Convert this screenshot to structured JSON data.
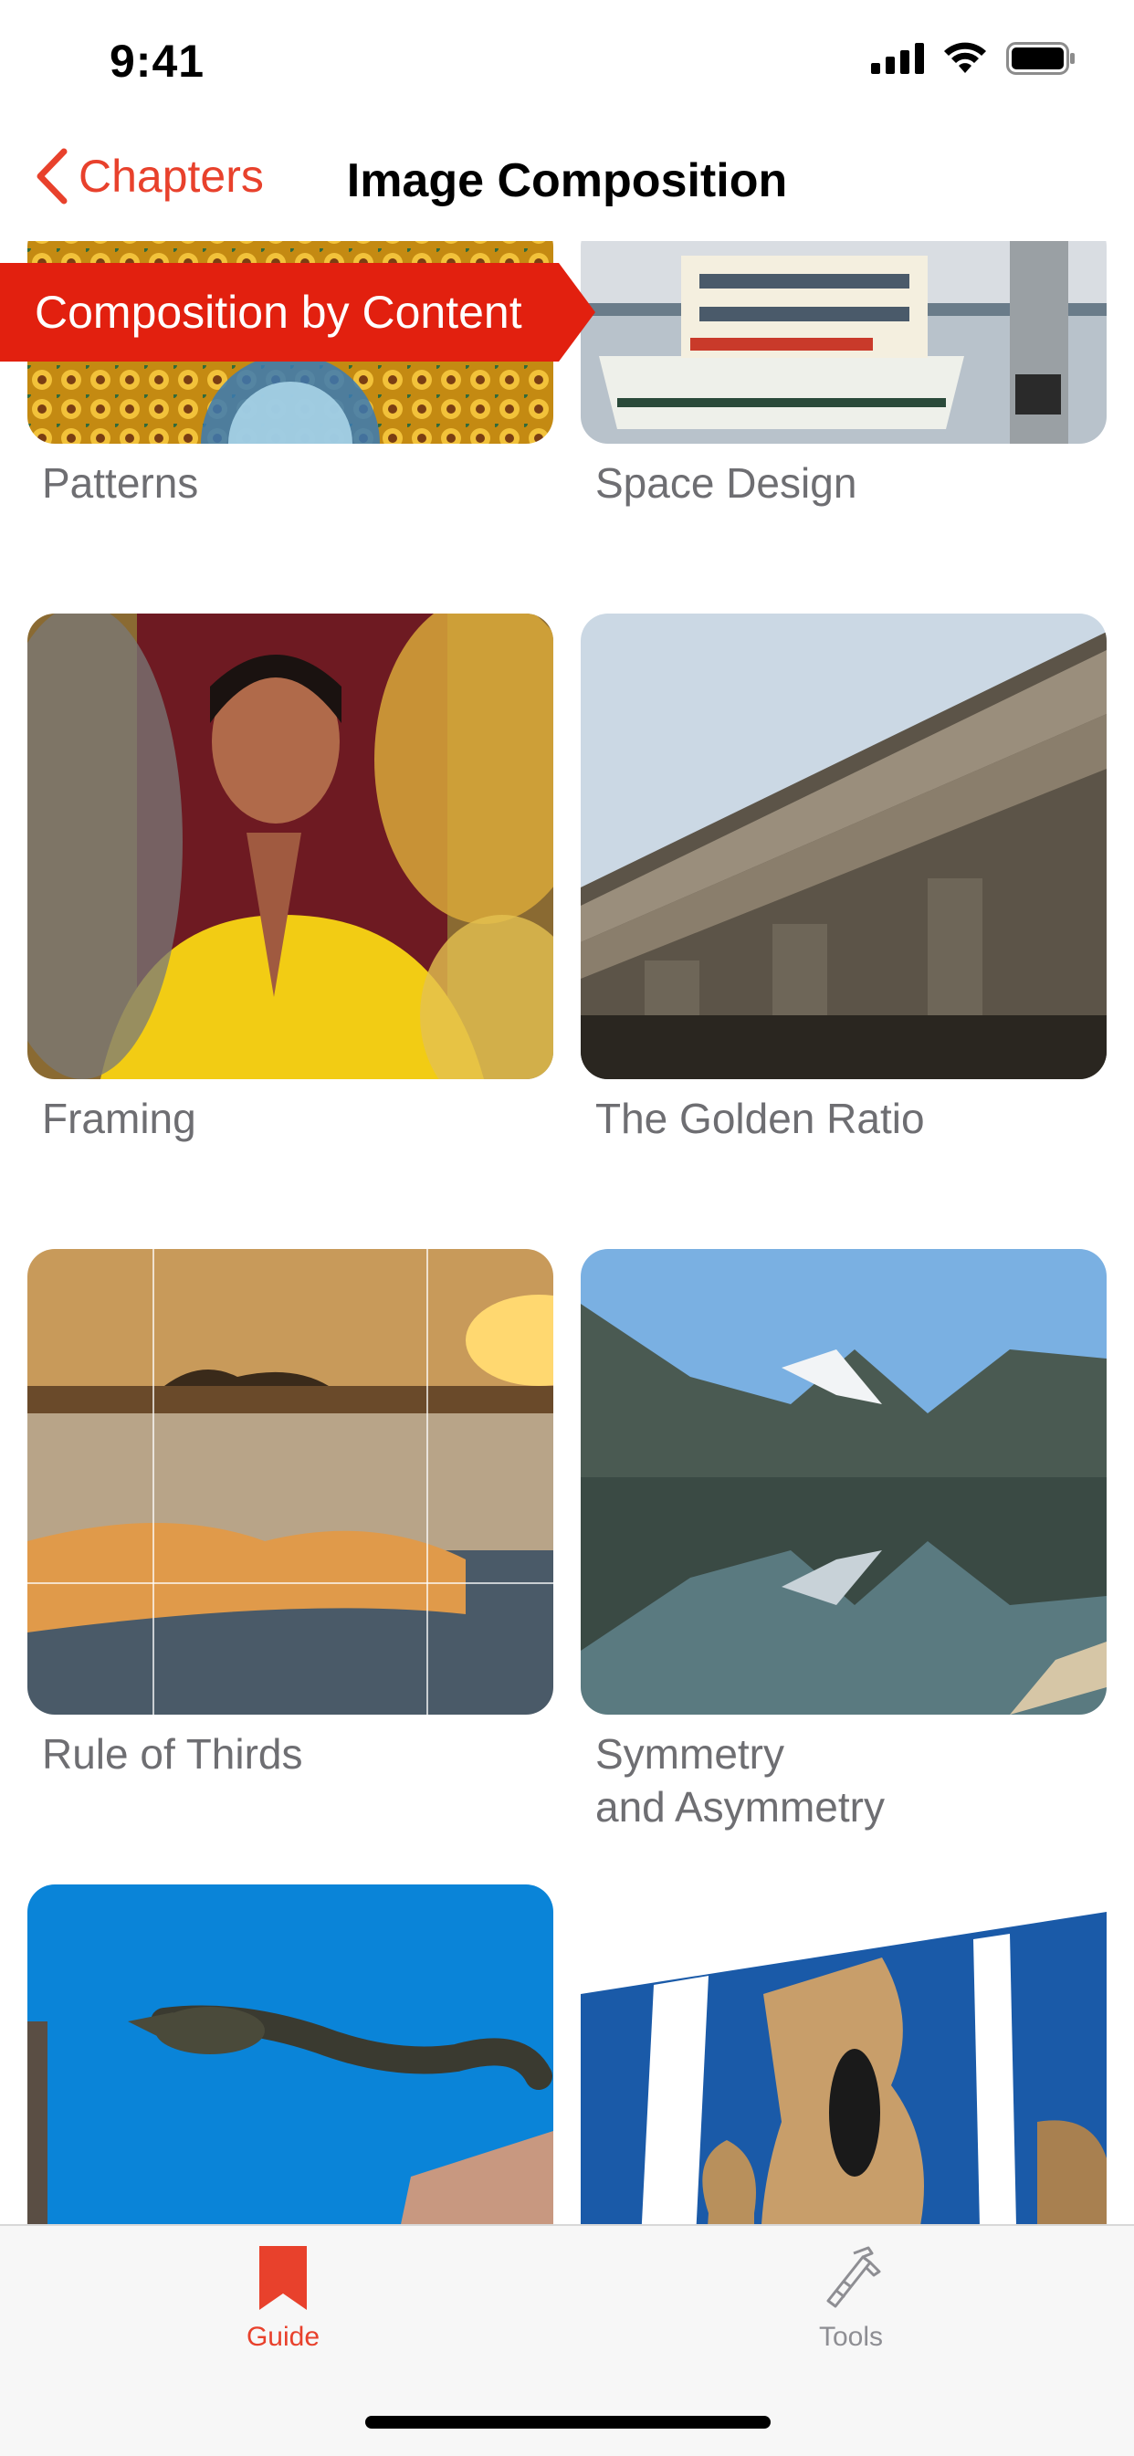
{
  "status_bar": {
    "time": "9:41"
  },
  "nav": {
    "back_label": "Chapters",
    "title": "Image Composition"
  },
  "section_banner": "Composition by Content",
  "items": [
    {
      "label": "Patterns"
    },
    {
      "label": "Space Design"
    },
    {
      "label": "Framing"
    },
    {
      "label": "The Golden Ratio"
    },
    {
      "label": "Rule of Thirds"
    },
    {
      "label": "Symmetry\nand Asymmetry"
    },
    {
      "label": ""
    },
    {
      "label": ""
    }
  ],
  "tabs": [
    {
      "label": "Guide",
      "active": true
    },
    {
      "label": "Tools",
      "active": false
    }
  ],
  "colors": {
    "accent": "#e8412c",
    "banner": "#e2200f",
    "inactive_tab": "#8e8e93"
  }
}
